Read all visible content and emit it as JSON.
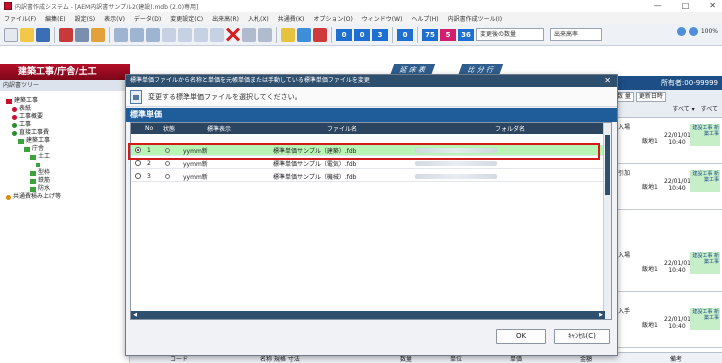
{
  "window": {
    "title": "内訳書作成システム - [AEM内訳書サンプル2(建設).mdb (2.0)専用]",
    "controls": [
      "—",
      "□",
      "✕"
    ]
  },
  "menu": [
    "ファイル(F)",
    "編集(E)",
    "設定(S)",
    "表示(V)",
    "データ(D)",
    "変更設定(C)",
    "出来高(R)",
    "入札(X)",
    "共通費(K)",
    "オプション(O)",
    "ウィンドウ(W)",
    "ヘルプ(H)",
    "内訳書作成ツール(I)"
  ],
  "toolbar": {
    "numbers": [
      {
        "value": "0",
        "color": "#1f6fd0"
      },
      {
        "value": "0",
        "color": "#1f6fd0"
      },
      {
        "value": "3",
        "color": "#1f6fd0"
      },
      {
        "value": "0",
        "color": "#1f6fd0"
      },
      {
        "value": "75",
        "color": "#1f6fd0"
      },
      {
        "value": "5",
        "color": "#d21e6e"
      },
      {
        "value": "36",
        "color": "#1f6fd0"
      }
    ],
    "field1": "変更後の数量",
    "field2": "出来高率",
    "zoom": "100%"
  },
  "left_panel": {
    "header": "建築工事/庁舎/土工",
    "tree_label": "内訳書ツリー",
    "tree": [
      {
        "label": "建築工事",
        "color": "#c8102e",
        "indent": 0
      },
      {
        "label": "表紙",
        "color": "#c8102e",
        "indent": 1
      },
      {
        "label": "工事概要",
        "color": "#c8102e",
        "indent": 1
      },
      {
        "label": "工事",
        "color": "#2b8a2b",
        "indent": 1
      },
      {
        "label": "直接工事費",
        "color": "#2b8a2b",
        "indent": 1
      },
      {
        "label": "建築工事",
        "color": "#2b8a2b",
        "indent": 2
      },
      {
        "label": "庁舎",
        "color": "#2b8a2b",
        "indent": 3
      },
      {
        "label": "土工",
        "color": "#2b8a2b",
        "indent": 4
      },
      {
        "label": "",
        "color": "#2b8a2b",
        "indent": 5
      },
      {
        "label": "型枠",
        "color": "#2b8a2b",
        "indent": 4
      },
      {
        "label": "鉄筋",
        "color": "#2b8a2b",
        "indent": 4
      },
      {
        "label": "防水",
        "color": "#2b8a2b",
        "indent": 4
      },
      {
        "label": "共通費積み上げ等",
        "color": "#e08a00",
        "indent": 0
      }
    ]
  },
  "background": {
    "tabs": [
      "延 床 表",
      "比 分 行"
    ],
    "right_header": "所有者:00-99999",
    "filter1": "数 量",
    "filter2": "更新日時",
    "filter3": "すべて ▾",
    "filter4": "すべて",
    "rows": [
      {
        "place": "入場",
        "who": "飯地1",
        "date": "22/01/01 10:40",
        "note": "建設工事 新築工事"
      },
      {
        "place": "引加",
        "who": "飯地1",
        "date": "22/01/01 10:40",
        "note": "建設工事 新築工事"
      },
      {
        "place": "入場",
        "who": "飯地1",
        "date": "22/01/01 10:40",
        "note": "建設工事 新築工事"
      },
      {
        "place": "入手",
        "who": "飯地1",
        "date": "22/01/01 10:40",
        "note": "建設工事 新築工事"
      }
    ],
    "bottom": [
      "コード",
      "名称 規格 寸法",
      "数量",
      "単位",
      "単価",
      "金額",
      "備考"
    ]
  },
  "dialog": {
    "title": "標準単価ファイルから名称と単価を元帳単価または手動している標準単価ファイルを変更",
    "instruction": "変更する標準単価ファイルを選択してください。",
    "section": "標準単価",
    "columns": {
      "no": "No",
      "status": "状態",
      "label": "標準表示",
      "file": "ファイル名",
      "folder": "フォルダ名"
    },
    "rows": [
      {
        "no": "1",
        "label": "yymm新",
        "file": "標準単価サンプル（建築）.fdb",
        "selected": true
      },
      {
        "no": "2",
        "label": "yymm新",
        "file": "標準単価サンプル（電気）.fdb",
        "selected": false
      },
      {
        "no": "3",
        "label": "yymm新",
        "file": "標準単価サンプル（機械）.fdb",
        "selected": false
      }
    ],
    "ok": "OK",
    "cancel": "ｷｬﾝｾﾙ(C)"
  }
}
